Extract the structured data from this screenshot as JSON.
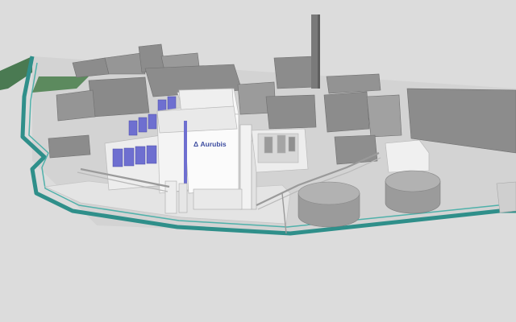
{
  "building_sign": {
    "logo_symbol": "Δ",
    "logo_text": "Aurubis"
  },
  "colors": {
    "ground": "#dcdcdc",
    "road": "#e6e6e6",
    "canal": "#2f8f8a",
    "grass": "#4a7a52",
    "building_grey": "#8c8c8c",
    "plant_white": "#f2f2f2",
    "solar_blue": "#6e6fd0",
    "tank_grey": "#a0a0a0"
  }
}
